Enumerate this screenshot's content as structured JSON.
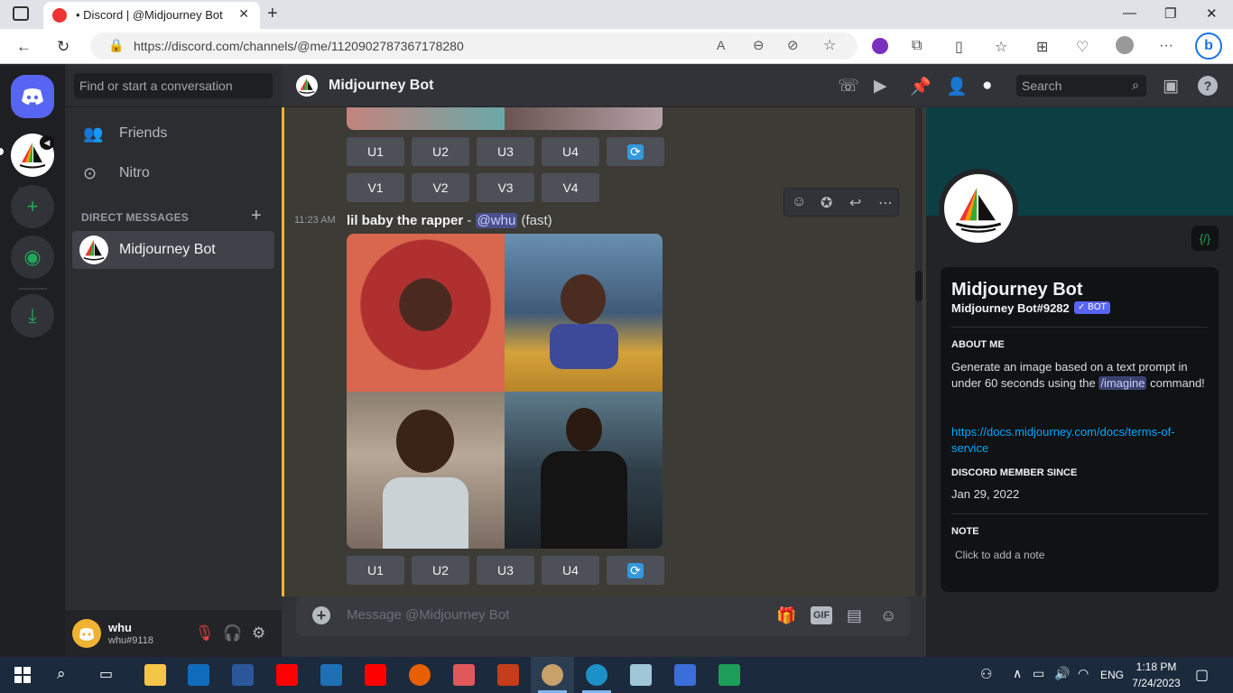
{
  "browser": {
    "tab_title": "• Discord | @Midjourney Bot",
    "url": "https://discord.com/channels/@me/1120902787367178280"
  },
  "sidebar": {
    "search_placeholder": "Find or start a conversation",
    "nav": [
      {
        "label": "Friends",
        "icon": "friends-icon"
      },
      {
        "label": "Nitro",
        "icon": "nitro-icon"
      }
    ],
    "dm_header": "DIRECT MESSAGES",
    "dm_items": [
      {
        "name": "Midjourney Bot"
      }
    ]
  },
  "user": {
    "name": "whu",
    "tag": "whu#9118"
  },
  "chat": {
    "title": "Midjourney Bot",
    "search_placeholder": "Search",
    "top_upscale": [
      "U1",
      "U2",
      "U3",
      "U4"
    ],
    "top_variation": [
      "V1",
      "V2",
      "V3",
      "V4"
    ],
    "message": {
      "time": "11:23 AM",
      "prompt": "lil baby the rapper",
      "separator": " - ",
      "mention": "@whu",
      "mode": " (fast)"
    },
    "bottom_upscale": [
      "U1",
      "U2",
      "U3",
      "U4"
    ],
    "composer_placeholder": "Message @Midjourney Bot",
    "gif_label": "GIF"
  },
  "profile": {
    "name": "Midjourney Bot",
    "tag": "Midjourney Bot#9282",
    "badge": "✓ BOT",
    "code_icon": "{/}",
    "about_header": "ABOUT ME",
    "about_text_1": "Generate an image based on a text prompt in under 60 seconds using the ",
    "about_command": "/imagine",
    "about_text_2": " command!",
    "link": "https://docs.midjourney.com/docs/terms-of-service",
    "member_since_header": "DISCORD MEMBER SINCE",
    "member_since": "Jan 29, 2022",
    "note_header": "NOTE",
    "note_placeholder": "Click to add a note"
  },
  "taskbar": {
    "time": "1:18 PM",
    "date": "7/24/2023",
    "lang": "ENG"
  },
  "colors": {
    "accent_blurple": "#5865f2",
    "unread_bar": "#f0b232",
    "banner": "#0c3f44",
    "green": "#23a55a"
  }
}
